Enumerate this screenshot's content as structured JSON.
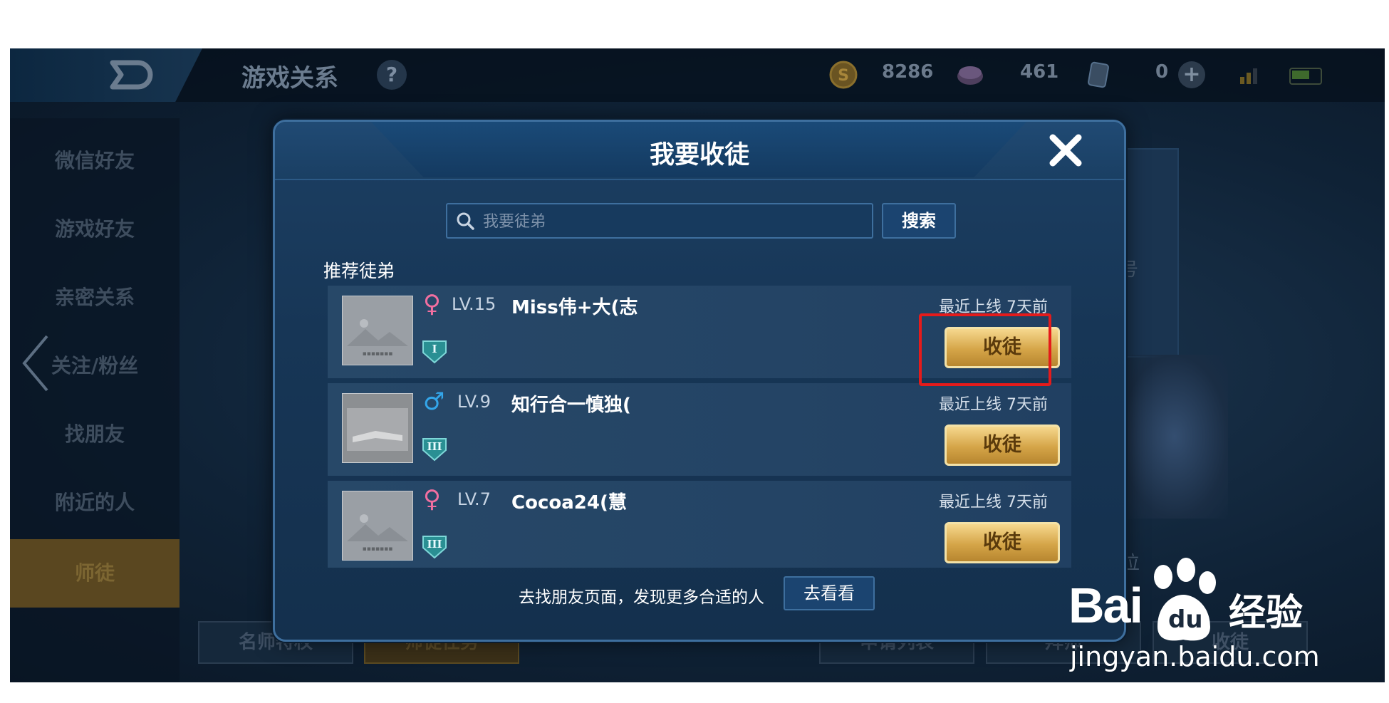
{
  "topbar": {
    "title": "游戏关系",
    "help": "?",
    "currencies": [
      {
        "icon": "gold-coin-icon",
        "value": "8286"
      },
      {
        "icon": "diamond-icon",
        "value": "461"
      },
      {
        "icon": "voucher-icon",
        "value": "0"
      }
    ],
    "plus": "+"
  },
  "sidebar": {
    "items": [
      {
        "label": "微信好友"
      },
      {
        "label": "游戏好友"
      },
      {
        "label": "亲密关系"
      },
      {
        "label": "关注/粉丝"
      },
      {
        "label": "找朋友"
      },
      {
        "label": "附近的人"
      },
      {
        "label": "师徒",
        "active": true
      }
    ]
  },
  "bottom_buttons": [
    "名师特权",
    "师徒任务",
    "申请列表",
    "拜师",
    "收徒"
  ],
  "background": {
    "side_text_1": "号",
    "side_text_2": "位"
  },
  "dialog": {
    "title": "我要收徒",
    "search": {
      "placeholder": "我要徒弟",
      "button": "搜索"
    },
    "section_label": "推荐徒弟",
    "recommended": [
      {
        "gender": "female",
        "level": "LV.15",
        "name": "Miss伟+大(志",
        "rank_icon": "I",
        "last_online": "最近上线 7天前",
        "action": "收徒"
      },
      {
        "gender": "male",
        "level": "LV.9",
        "name": "知行合一慎独(",
        "rank_icon": "III",
        "last_online": "最近上线 7天前",
        "action": "收徒"
      },
      {
        "gender": "female",
        "level": "LV.7",
        "name": "Cocoa24(慧",
        "rank_icon": "III",
        "last_online": "最近上线 7天前",
        "action": "收徒"
      }
    ],
    "footer": {
      "text": "去找朋友页面，发现更多合适的人",
      "button": "去看看"
    }
  },
  "watermark": {
    "bai": "Bai",
    "du": "du",
    "jingyan": "经验",
    "url": "jingyan.baidu.com"
  },
  "colors": {
    "accent_gold": "#d5a548",
    "highlight_red": "#e51b1b",
    "dialog_blue": "#173656"
  }
}
